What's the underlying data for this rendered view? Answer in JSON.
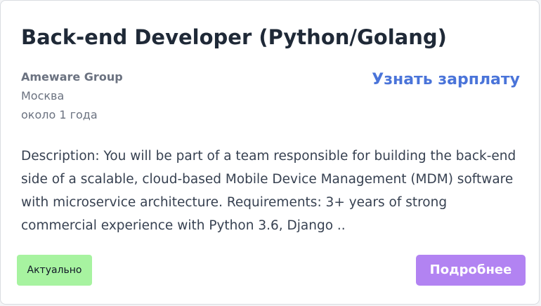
{
  "job": {
    "title": "Back-end Developer (Python/Golang)",
    "company": "Ameware Group",
    "city": "Москва",
    "posted": "около 1 года",
    "salary_link": "Узнать зарплату",
    "description": "Description: You will be part of a team responsible for building the back-end side of a scalable, cloud-based Mobile Device Management (MDM) software with microservice architecture. Requirements: 3+ years of strong commercial experience with Python 3.6, Django ..",
    "status": "Актуально",
    "details_button": "Подробнее"
  },
  "colors": {
    "title": "#1f2937",
    "link": "#4a74d9",
    "badge_bg": "#a7f3a0",
    "button_bg": "#b283f2"
  }
}
